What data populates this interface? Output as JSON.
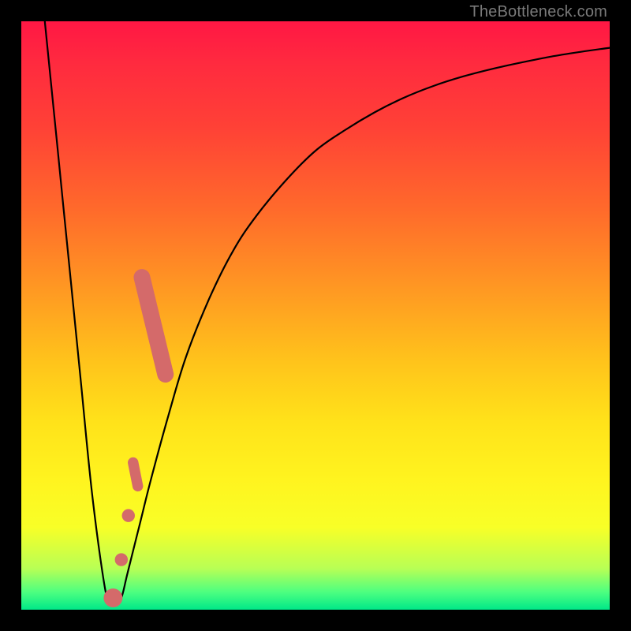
{
  "attribution": "TheBottleneck.com",
  "colors": {
    "frame": "#000000",
    "gradient_top": "#ff1744",
    "gradient_mid1": "#ff9a22",
    "gradient_mid2": "#fff41f",
    "gradient_bottom": "#00e888",
    "curve": "#000000",
    "marker": "#d46a6a"
  },
  "chart_data": {
    "type": "line",
    "title": "",
    "xlabel": "",
    "ylabel": "",
    "xlim": [
      0,
      100
    ],
    "ylim": [
      0,
      100
    ],
    "legend": false,
    "grid": false,
    "series": [
      {
        "name": "bottleneck-curve",
        "x": [
          4,
          6,
          8,
          10,
          12,
          14,
          15,
          16,
          17,
          18,
          20,
          22,
          25,
          28,
          32,
          36,
          40,
          45,
          50,
          55,
          60,
          65,
          70,
          75,
          80,
          85,
          90,
          95,
          100
        ],
        "y": [
          100,
          80,
          60,
          40,
          20,
          5,
          1,
          1,
          2,
          6,
          14,
          22,
          33,
          43,
          53,
          61,
          67,
          73,
          78,
          81.5,
          84.5,
          87,
          89,
          90.6,
          91.9,
          93,
          94,
          94.8,
          95.5
        ]
      }
    ],
    "markers": [
      {
        "name": "highlight-stroke-top",
        "x0": 20.5,
        "y0": 56.5,
        "x1": 24.5,
        "y1": 40.0,
        "width": 2.8
      },
      {
        "name": "highlight-stroke-mid",
        "x0": 19.0,
        "y0": 25.0,
        "x1": 19.8,
        "y1": 21.0,
        "width": 1.8
      },
      {
        "name": "highlight-dot-1",
        "cx": 18.2,
        "cy": 16.0,
        "r": 1.1
      },
      {
        "name": "highlight-dot-2",
        "cx": 17.0,
        "cy": 8.5,
        "r": 1.1
      },
      {
        "name": "highlight-dot-3",
        "cx": 15.6,
        "cy": 2.0,
        "r": 1.6
      }
    ]
  }
}
